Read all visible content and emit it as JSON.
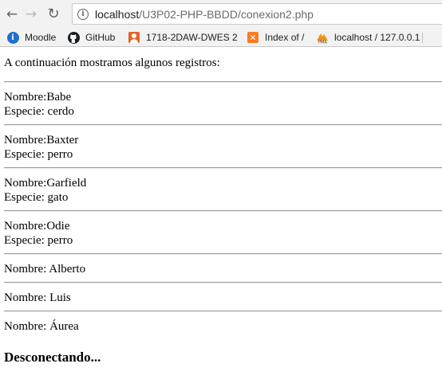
{
  "browser": {
    "url_host": "localhost",
    "url_path": "/U3P02-PHP-BBDD/conexion2.php",
    "icons": {
      "back": "back-arrow-icon",
      "forward": "forward-arrow-icon",
      "reload": "reload-icon",
      "info": "info-icon"
    }
  },
  "bookmarks": [
    {
      "label": "Moodle",
      "icon": "moodle-icon",
      "glyph": "i"
    },
    {
      "label": "GitHub",
      "icon": "github-icon",
      "glyph": "●"
    },
    {
      "label": "1718-2DAW-DWES 2",
      "icon": "user-icon",
      "glyph": ""
    },
    {
      "label": "Index of /",
      "icon": "xampp-icon",
      "glyph": "✕"
    },
    {
      "label": "localhost / 127.0.0.1",
      "icon": "phpmyadmin-icon",
      "glyph": ""
    }
  ],
  "page": {
    "intro": "A continuación mostramos algunos registros:",
    "animals": [
      {
        "nombre": "Nombre:Babe",
        "especie": "Especie: cerdo"
      },
      {
        "nombre": "Nombre:Baxter",
        "especie": "Especie: perro"
      },
      {
        "nombre": "Nombre:Garfield",
        "especie": "Especie: gato"
      },
      {
        "nombre": "Nombre:Odie",
        "especie": "Especie: perro"
      }
    ],
    "people": [
      "Nombre: Alberto",
      "Nombre: Luis",
      "Nombre: Áurea"
    ],
    "footer": "Desconectando..."
  }
}
